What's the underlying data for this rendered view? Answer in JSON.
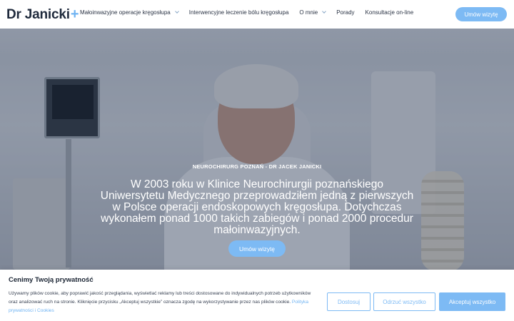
{
  "header": {
    "logo_text": "Dr Janicki",
    "logo_plus": "+",
    "nav": [
      {
        "label": "Małoinwazyjne operacje kręgosłupa",
        "has_dropdown": true
      },
      {
        "label": "Interwencyjne leczenie bólu kręgosłupa",
        "has_dropdown": false
      },
      {
        "label": "O mnie",
        "has_dropdown": true
      },
      {
        "label": "Porady",
        "has_dropdown": false
      },
      {
        "label": "Konsultacje on-line",
        "has_dropdown": false
      }
    ],
    "cta_label": "Umów wizytę"
  },
  "hero": {
    "subtitle": "NEUROCHIRURG POZNAŃ - DR JACEK JANICKI",
    "text": "W 2003 roku w Klinice Neurochirurgii poznańskiego Uniwersytetu Medycznego przeprowadziłem jedną z pierwszych w Polsce operacji endoskopowych kręgosłupa. Dotychczas wykonałem ponad 1000 takich zabiegów i ponad 2000 procedur małoinwazyjnych.",
    "cta_label": "Umów wizytę"
  },
  "cookie": {
    "title": "Cenimy Twoją prywatność",
    "text": "Używamy plików cookie, aby poprawić jakość przeglądania, wyświetlać reklamy lub treści dostosowane do indywidualnych potrzeb użytkowników oraz analizować ruch na stronie. Kliknięcie przycisku „Akceptuj wszystkie” oznacza zgodę na wykorzystywanie przez nas plików cookie.",
    "link_label": "Polityka prywatności i Cookies",
    "buttons": {
      "customize": "Dostosuj",
      "reject": "Odrzuć wszystko",
      "accept": "Akceptuj wszystko"
    }
  },
  "colors": {
    "accent": "#7dbaf4",
    "text_dark": "#1f2a3c"
  },
  "icons": [
    "chevron-down-icon",
    "plus-icon"
  ]
}
